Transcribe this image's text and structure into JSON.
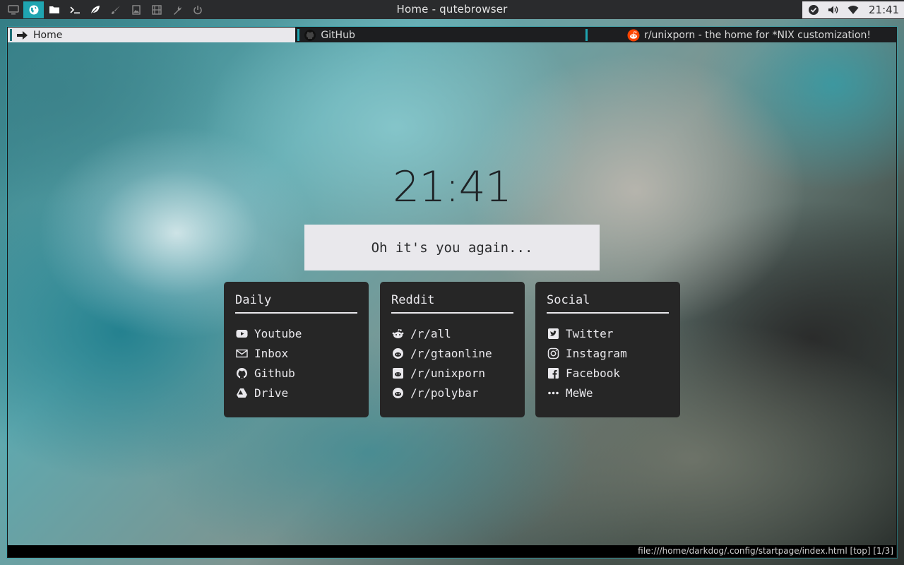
{
  "panel": {
    "workspaces": [
      {
        "icon": "monitor-icon",
        "active": false
      },
      {
        "icon": "globe-icon",
        "active": true
      },
      {
        "icon": "folder-icon",
        "active": false
      },
      {
        "icon": "terminal-icon",
        "active": false
      },
      {
        "icon": "leaf-icon",
        "active": false
      },
      {
        "icon": "brush-icon",
        "active": false
      },
      {
        "icon": "image-icon",
        "active": false
      },
      {
        "icon": "film-icon",
        "active": false
      },
      {
        "icon": "wrench-icon",
        "active": false
      },
      {
        "icon": "power-icon",
        "active": false
      }
    ],
    "title": "Home - qutebrowser",
    "tray": {
      "icons": [
        "check-circle-icon",
        "volume-icon",
        "wifi-icon"
      ],
      "clock": "21:41"
    }
  },
  "tabs": [
    {
      "title": "Home",
      "icon": "arrow-right-icon",
      "active": true
    },
    {
      "title": "GitHub",
      "icon": "github-icon",
      "active": false
    },
    {
      "title": "r/unixporn - the home for *NIX customization!",
      "icon": "reddit-icon",
      "active": false
    }
  ],
  "startpage": {
    "clock": "21:41",
    "greeting": "Oh it's you again...",
    "cards": [
      {
        "title": "Daily",
        "links": [
          {
            "label": "Youtube",
            "icon": "youtube-icon"
          },
          {
            "label": "Inbox",
            "icon": "envelope-icon"
          },
          {
            "label": "Github",
            "icon": "github-icon"
          },
          {
            "label": "Drive",
            "icon": "drive-icon"
          }
        ]
      },
      {
        "title": "Reddit",
        "links": [
          {
            "label": "/r/all",
            "icon": "reddit-alien-icon"
          },
          {
            "label": "/r/gtaonline",
            "icon": "reddit-icon"
          },
          {
            "label": "/r/unixporn",
            "icon": "reddit-square-icon"
          },
          {
            "label": "/r/polybar",
            "icon": "reddit-icon"
          }
        ]
      },
      {
        "title": "Social",
        "links": [
          {
            "label": "Twitter",
            "icon": "twitter-icon"
          },
          {
            "label": "Instagram",
            "icon": "instagram-icon"
          },
          {
            "label": "Facebook",
            "icon": "facebook-icon"
          },
          {
            "label": "MeWe",
            "icon": "ellipsis-icon"
          }
        ]
      }
    ]
  },
  "statusbar": {
    "url": "file:///home/darkdog/.config/startpage/index.html [top] [1/3]"
  },
  "colors": {
    "accent": "#1fa5b1",
    "panel": "#2a2b2d",
    "card": "#262626",
    "light": "#e9e8ec"
  }
}
